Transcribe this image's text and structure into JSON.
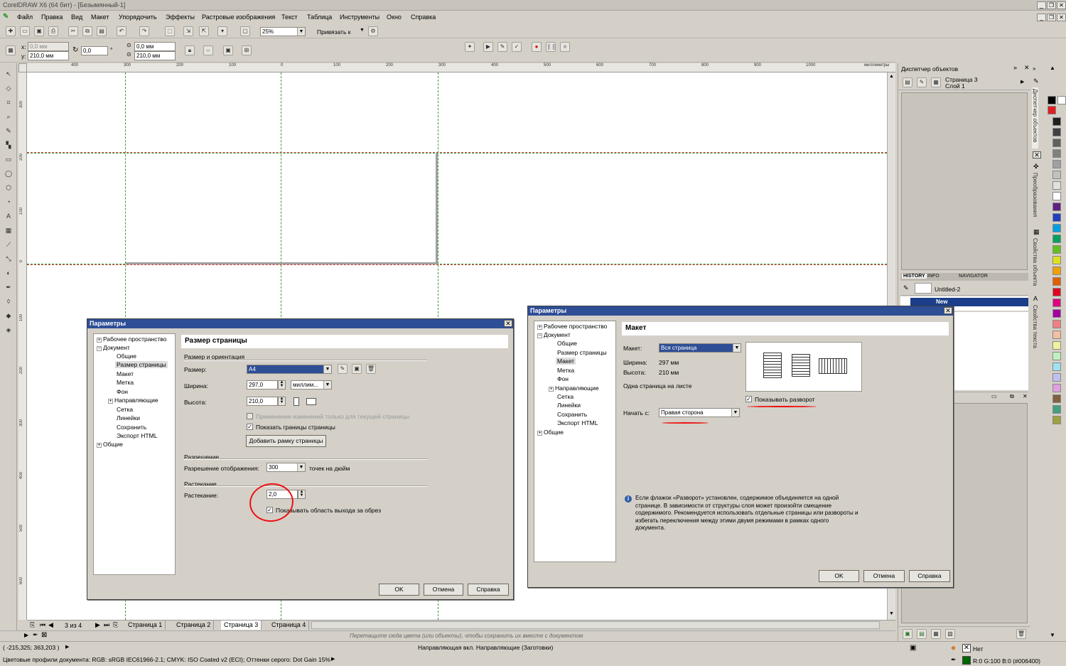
{
  "app": {
    "title": "CorelDRAW X6 (64 бит) - [Безымянный-1]",
    "menu": [
      "Файл",
      "Правка",
      "Вид",
      "Макет",
      "Упорядочить",
      "Эффекты",
      "Растровые изображения",
      "Текст",
      "Таблица",
      "Инструменты",
      "Окно",
      "Справка"
    ]
  },
  "toolbar": {
    "zoom": "25%",
    "snap": "Привязать к"
  },
  "propbar": {
    "x_label": "x:",
    "x_value": "0,0 мм",
    "y_label": "y:",
    "y_value": "210,0 мм",
    "rotation": "0,0",
    "deg": "°",
    "px": "0,0 мм",
    "py": "210,0 мм"
  },
  "ruler": {
    "unit": "миллиметры",
    "h_ticks": [
      "400",
      "300",
      "200",
      "100",
      "0",
      "100",
      "200",
      "300",
      "400",
      "500",
      "600",
      "700",
      "800",
      "900",
      "1000"
    ],
    "v_ticks": [
      "300",
      "200",
      "100",
      "0",
      "100",
      "200",
      "300",
      "400",
      "500",
      "600"
    ],
    "v_unit": "миллиметры"
  },
  "pagebar": {
    "count": "3 из 4",
    "tabs": [
      "Страница 1",
      "Страница 2",
      "Страница 3",
      "Страница 4"
    ],
    "active": "Страница 3"
  },
  "palette_hint": "Перетащите сюда цвета (или объекты), чтобы сохранить их вместе с документом",
  "status": {
    "coords": "( -215,325; 363,203 )",
    "center": "Направляющая вкл. Направляющие  (Заготовки)",
    "profiles": "Цветовые профили документа: RGB: sRGB IEC61966-2.1; CMYK: ISO Coated v2 (ECI); Оттенки серого: Dot Gain 15%",
    "fill": "Нет",
    "color": "R:0 G:100 B:0 (#006400)"
  },
  "docker": {
    "title": "Диспетчер объектов",
    "page": "Страница 3",
    "layer": "Слой 1",
    "tabs": [
      "HISTORY",
      "INFO",
      "NAVIGATOR"
    ],
    "history_item": "Untitled-2",
    "history_sel": "New",
    "vtabs": [
      "Диспетчер объектов",
      "Преобразования",
      "Свойства объекта",
      "Свойства текста"
    ]
  },
  "dialog1": {
    "title": "Параметры",
    "tree": [
      "Рабочее пространство",
      "Документ",
      "Общие",
      "Размер страницы",
      "Макет",
      "Метка",
      "Фон",
      "Направляющие",
      "Сетка",
      "Линейки",
      "Сохранить",
      "Экспорт HTML",
      "Общие"
    ],
    "header": "Размер страницы",
    "group1": "Размер и ориентация",
    "size_label": "Размер:",
    "size_value": "A4",
    "width_label": "Ширина:",
    "width_value": "297,0",
    "unit": "миллим...",
    "height_label": "Высота:",
    "height_value": "210,0",
    "cb_apply": "Применение изменений только для текущей страницы",
    "cb_borders": "Показать границы страницы",
    "add_frame": "Добавить рамку страницы",
    "group2": "Разрешение",
    "res_label": "Разрешение отображения:",
    "res_value": "300",
    "res_unit": "точек на дюйм",
    "group3": "Растекание",
    "bleed_label": "Растекание:",
    "bleed_value": "2,0",
    "cb_bleed": "Показывать область выхода за обрез",
    "ok": "OK",
    "cancel": "Отмена",
    "help": "Справка"
  },
  "dialog2": {
    "title": "Параметры",
    "tree": [
      "Рабочее пространство",
      "Документ",
      "Общие",
      "Размер страницы",
      "Макет",
      "Метка",
      "Фон",
      "Направляющие",
      "Сетка",
      "Линейки",
      "Сохранить",
      "Экспорт HTML",
      "Общие"
    ],
    "header": "Макет",
    "layout_label": "Макет:",
    "layout_value": "Вся страница",
    "width_label": "Ширина:",
    "width_value": "297 мм",
    "height_label": "Высота:",
    "height_value": "210 мм",
    "desc": "Одна страница на листе",
    "cb_spread": "Показывать разворот",
    "start_label": "Начать с:",
    "start_value": "Правая сторона",
    "info": "Если флажок «Разворот» установлен, содержимое объединяется на одной странице. В зависимости от структуры слоя может произойти смещение содержимого. Рекомендуется использовать отдельные страницы или развороты и избегать переключения между этими двумя режимами в рамках одного документа.",
    "ok": "OK",
    "cancel": "Отмена",
    "help": "Справка"
  },
  "palette_colors": [
    "#000000",
    "#ffffff",
    "#e02020",
    "#202020",
    "#404040",
    "#606060",
    "#808080",
    "#a0a0a0",
    "#c0c0c0",
    "#e0e0e0",
    "#ffffff",
    "#602080",
    "#2040c0",
    "#00a0e0",
    "#00a060",
    "#60c020",
    "#e0e020",
    "#f0a000",
    "#e06000",
    "#e00020",
    "#e00080",
    "#a000a0",
    "#f08080",
    "#f0c0a0",
    "#f0f0a0",
    "#c0f0c0",
    "#a0e0f0",
    "#c0c0f0",
    "#e0a0e0",
    "#806040",
    "#40a080",
    "#a0a040"
  ]
}
